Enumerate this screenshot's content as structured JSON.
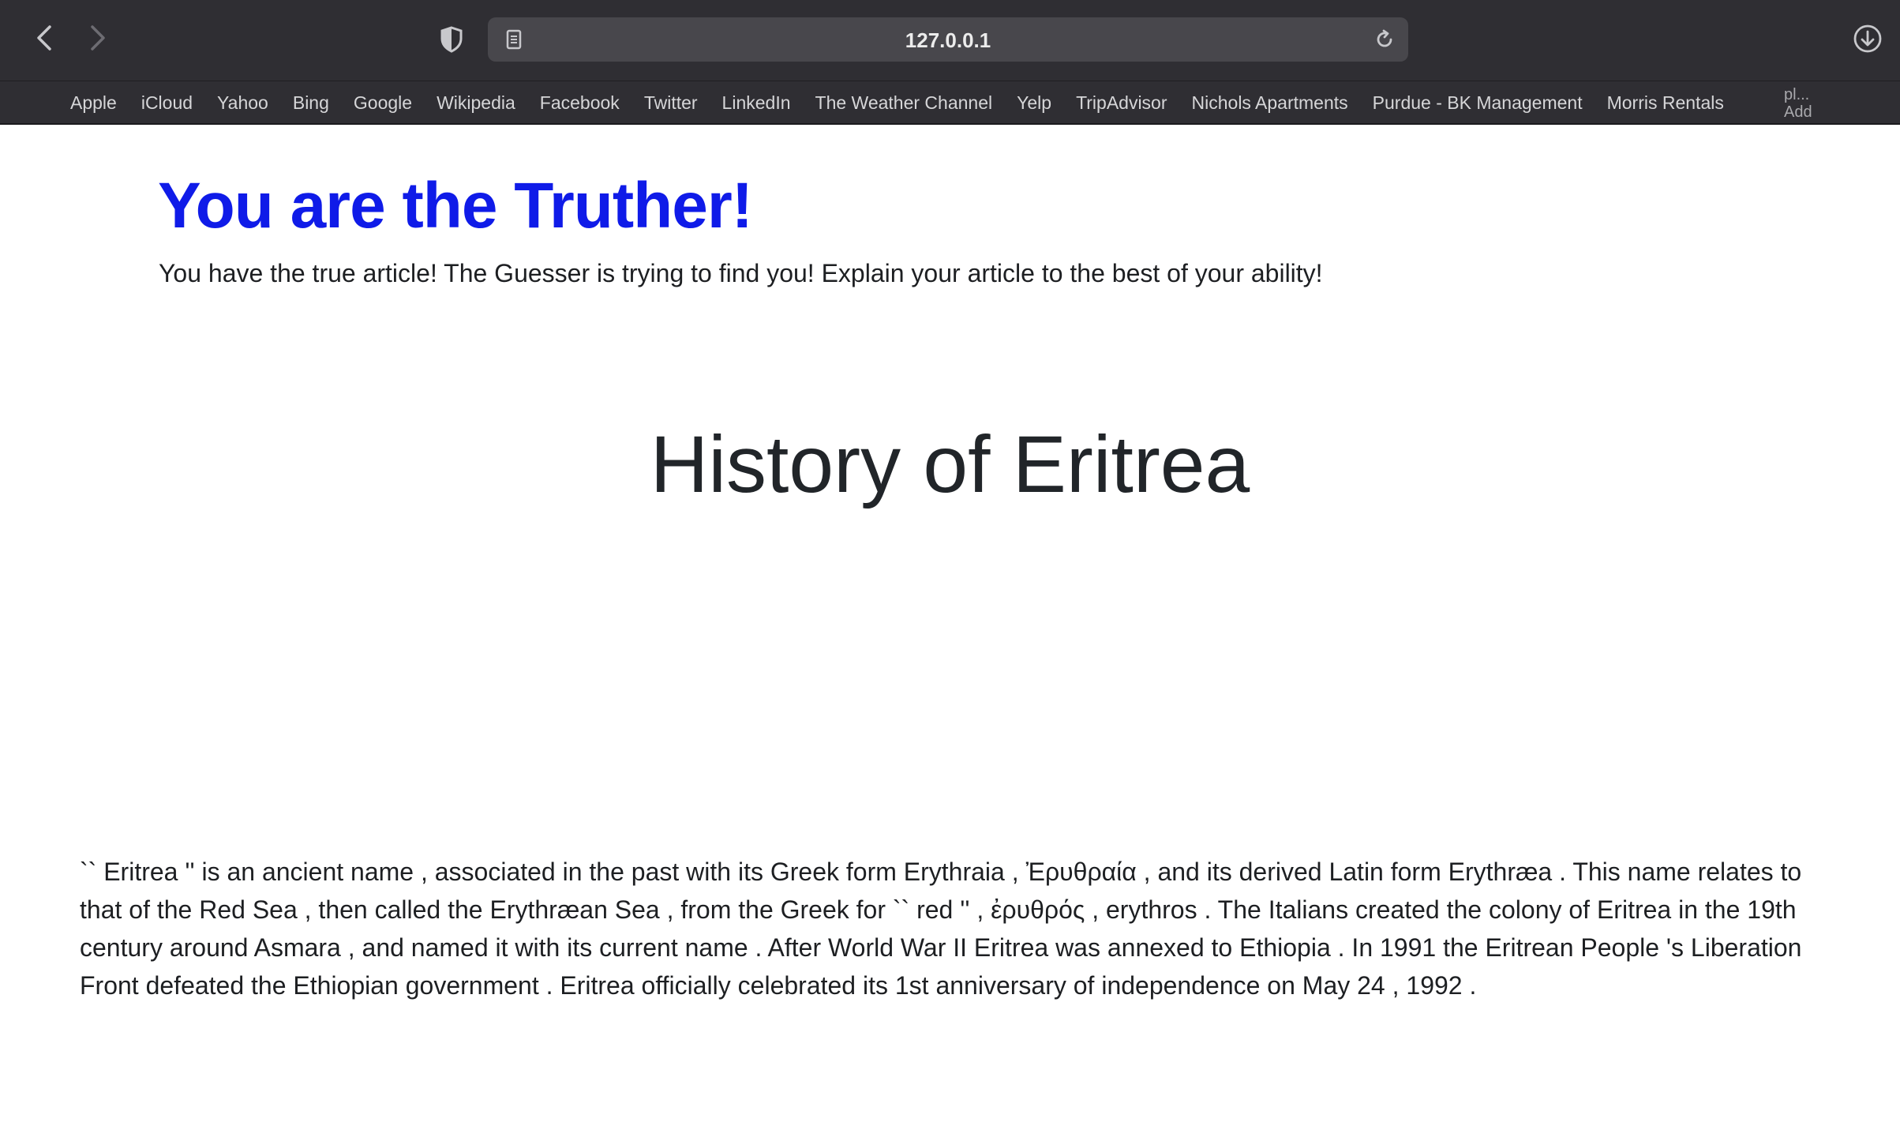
{
  "browser": {
    "url": "127.0.0.1",
    "icons": {
      "back": "chevron-left-icon",
      "forward": "chevron-right-icon",
      "privacy": "shield-icon",
      "reader": "reader-icon",
      "reload": "reload-icon",
      "downloads": "download-icon"
    },
    "favorites": [
      "Apple",
      "iCloud",
      "Yahoo",
      "Bing",
      "Google",
      "Wikipedia",
      "Facebook",
      "Twitter",
      "LinkedIn",
      "The Weather Channel",
      "Yelp",
      "TripAdvisor",
      "Nichols Apartments",
      "Purdue - BK Management",
      "Morris Rentals"
    ],
    "favorites_overflow": "pl... Add"
  },
  "page": {
    "role_title": "You are the Truther!",
    "instructions": "You have the true article! The Guesser is trying to find you! Explain your article to the best of your ability!",
    "article_title": "History of Eritrea",
    "article_body": "`` Eritrea '' is an ancient name , associated in the past with its Greek form Erythraia , Ἐρυθραία , and its derived Latin form Erythræa . This name relates to that of the Red Sea , then called the Erythræan Sea , from the Greek for `` red '' , ἐρυθρός , erythros . The Italians created the colony of Eritrea in the 19th century around Asmara , and named it with its current name . After World War II Eritrea was annexed to Ethiopia . In 1991 the Eritrean People 's Liberation Front defeated the Ethiopian government . Eritrea officially celebrated its 1st anniversary of independence on May 24 , 1992 ."
  },
  "colors": {
    "chrome_bg": "#2f2e33",
    "address_bg": "#48474c",
    "title_blue": "#0f1be8",
    "text_dark": "#1d1f22"
  }
}
